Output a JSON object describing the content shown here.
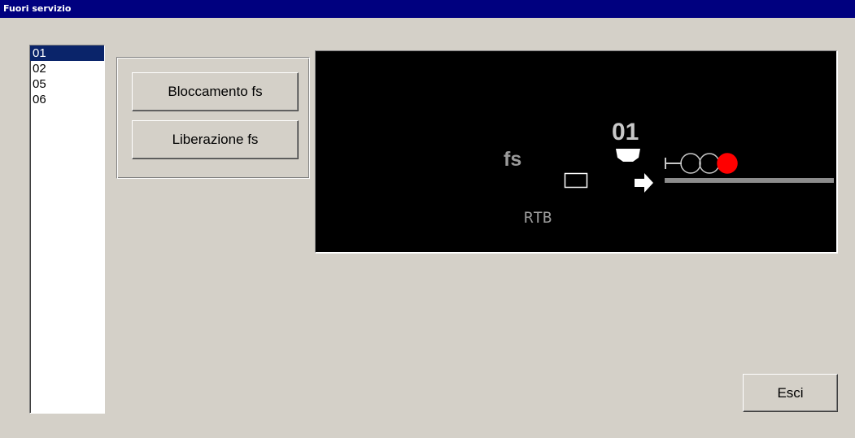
{
  "window": {
    "title": "Fuori servizio"
  },
  "list": {
    "items": [
      "01",
      "02",
      "05",
      "06"
    ],
    "selected_index": 0
  },
  "buttons": {
    "bloccamento": "Bloccamento fs",
    "liberazione": "Liberazione fs",
    "esci": "Esci"
  },
  "display": {
    "signal_number": "01",
    "fs_label": "fs",
    "rtb_label": "RTB",
    "signal_aspects": [
      "off",
      "off",
      "red"
    ]
  },
  "colors": {
    "titlebar": "#00007f",
    "selection": "#0a246a",
    "background": "#d4d0c8",
    "display_background": "#000000",
    "signal_red": "#ff0000",
    "label_grey": "#9a9a9a",
    "track_grey": "#8c8c8c"
  }
}
